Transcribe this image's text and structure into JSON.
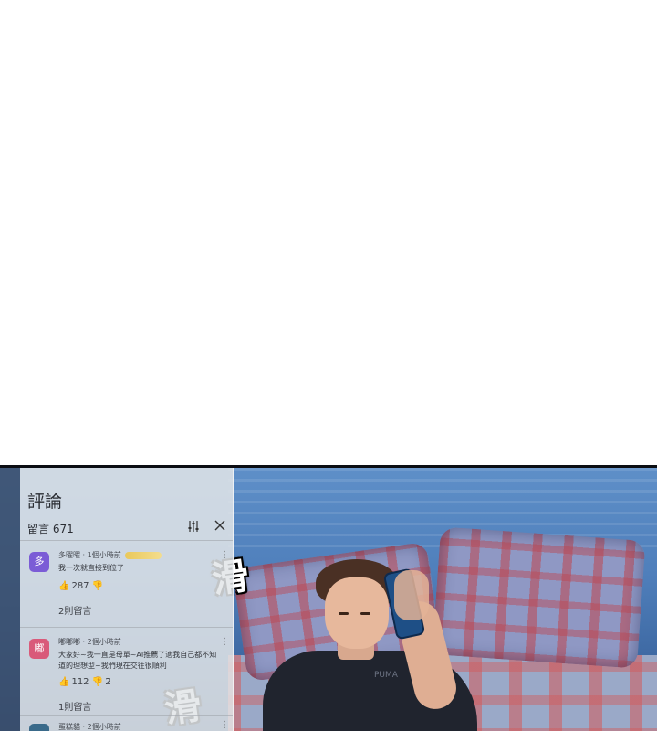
{
  "comments_panel": {
    "title": "評論",
    "count_label": "留言 671",
    "filter_icon": "sliders-icon",
    "close_icon": "close-icon",
    "items": [
      {
        "avatar_char": "多",
        "avatar_color": "#7b5cd6",
        "username": "多曜曜 · 1個小時前",
        "text": "我一次就直接到位了",
        "likes": "287",
        "dislikes": "",
        "replies": "2則留言"
      },
      {
        "avatar_char": "嘟",
        "avatar_color": "#d95a7a",
        "username": "嘟嘟嘟 · 2個小時前",
        "text": "大家好~我一直是母單~AI推薦了適我自己都不知道的理想型~我們現在交往很順利",
        "likes": "112",
        "dislikes": "2",
        "replies": "1則留言"
      },
      {
        "username": "蛋糕貓 · 2個小時前"
      }
    ]
  },
  "scene": {
    "sfx_1": "滑",
    "sfx_2": "滑",
    "shirt_logo": "PUMA"
  }
}
